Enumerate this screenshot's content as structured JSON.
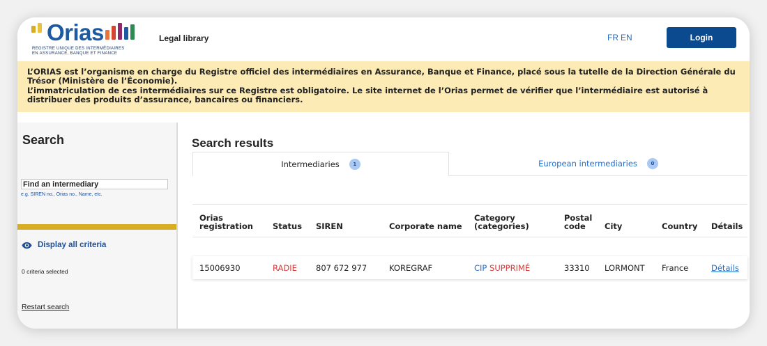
{
  "header": {
    "logo_text": "Orias",
    "logo_subtitle_1": "REGISTRE UNIQUE DES INTERMÉDIAIRES",
    "logo_subtitle_2": "EN ASSURANCE, BANQUE ET FINANCE",
    "legal_library": "Legal library",
    "lang_fr": "FR",
    "lang_en": "EN",
    "login_label": "Login"
  },
  "banner": {
    "line1": "L’ORIAS est l’organisme en charge du Registre officiel des intermédiaires en Assurance, Banque et Finance, placé sous la tutelle de la Direction Générale du Trésor (Ministère de l’Économie).",
    "line2": "L’immatriculation de ces intermédiaires sur ce Registre est obligatoire. Le site internet de l’Orias permet de vérifier que l’intermédiaire est autorisé à distribuer des produits d’assurance, bancaires ou financiers."
  },
  "sidebar": {
    "title": "Search",
    "find_placeholder": "Find an intermediary",
    "hint": "e.g. SIREN no., Orias no., Name, etc.",
    "display_all": "Display all criteria",
    "criteria_selected": "0 criteria selected",
    "restart": "Restart search"
  },
  "main": {
    "title": "Search results",
    "tabs": [
      {
        "label": "Intermediaries",
        "count": "1"
      },
      {
        "label": "European intermediaries",
        "count": "0"
      }
    ],
    "columns": {
      "orias_1": "Orias",
      "orias_2": "registration",
      "status": "Status",
      "siren": "SIREN",
      "corporate": "Corporate name",
      "category_1": "Category",
      "category_2": "(categories)",
      "postal_1": "Postal",
      "postal_2": "code",
      "city": "City",
      "country": "Country",
      "details": "Détails"
    },
    "row": {
      "orias": "15006930",
      "status": "RADIE",
      "siren": "807 672 977",
      "corporate": "KOREGRAF",
      "category_code": "CIP",
      "category_state": "SUPPRIMÉ",
      "postal": "33310",
      "city": "LORMONT",
      "country": "France",
      "details": "Détails"
    }
  },
  "colors": {
    "brand_blue": "#1e5aa0",
    "login_bg": "#0c4a8f",
    "banner_bg": "#fcebb5",
    "gold": "#d8ad22",
    "link": "#1f6fd1",
    "status_red": "#d53a3a"
  },
  "icons": {
    "eye": "eye-icon"
  }
}
